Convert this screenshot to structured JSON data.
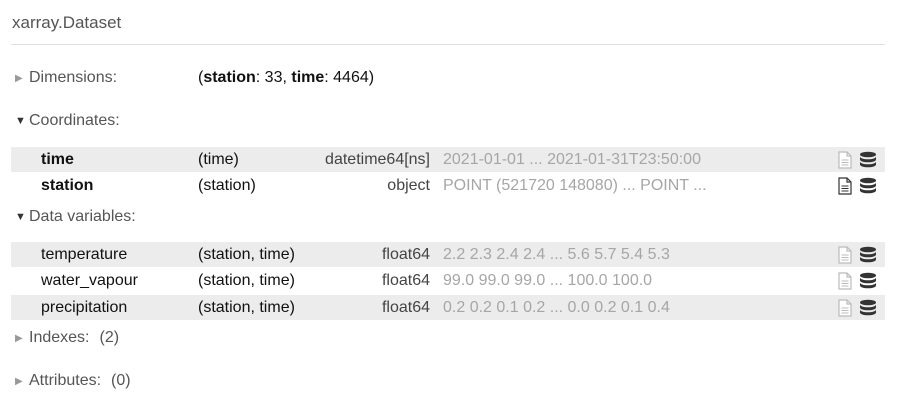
{
  "header": {
    "title": "xarray.Dataset"
  },
  "sections": {
    "dimensions": {
      "label": "Dimensions:",
      "open": "(",
      "sep": ", ",
      "close": ")"
    },
    "coordinates": {
      "label": "Coordinates:"
    },
    "data_variables": {
      "label": "Data variables:"
    },
    "indexes": {
      "label": "Indexes:",
      "count": "(2)"
    },
    "attributes": {
      "label": "Attributes:",
      "count": "(0)"
    }
  },
  "dimensions": [
    {
      "name": "station",
      "value": ": 33"
    },
    {
      "name": "time",
      "value": ": 4464"
    }
  ],
  "coordinates": [
    {
      "name": "time",
      "dims": "(time)",
      "dtype": "datetime64[ns]",
      "preview": "2021-01-01 ... 2021-01-31T23:50:00"
    },
    {
      "name": "station",
      "dims": "(station)",
      "dtype": "object",
      "preview": "POINT (521720 148080) ... POINT ..."
    }
  ],
  "data_variables": [
    {
      "name": "temperature",
      "dims": "(station, time)",
      "dtype": "float64",
      "preview": "2.2 2.3 2.4 2.4 ... 5.6 5.7 5.4 5.3"
    },
    {
      "name": "water_vapour",
      "dims": "(station, time)",
      "dtype": "float64",
      "preview": "99.0 99.0 99.0 ... 100.0 100.0"
    },
    {
      "name": "precipitation",
      "dims": "(station, time)",
      "dtype": "float64",
      "preview": "0.2 0.2 0.1 0.2 ... 0.0 0.2 0.1 0.4"
    }
  ],
  "icons": {
    "attrs": "file-text-icon",
    "data": "database-icon"
  },
  "colors": {
    "row_shade": "#ececec",
    "muted_text": "#a6a6a6"
  }
}
